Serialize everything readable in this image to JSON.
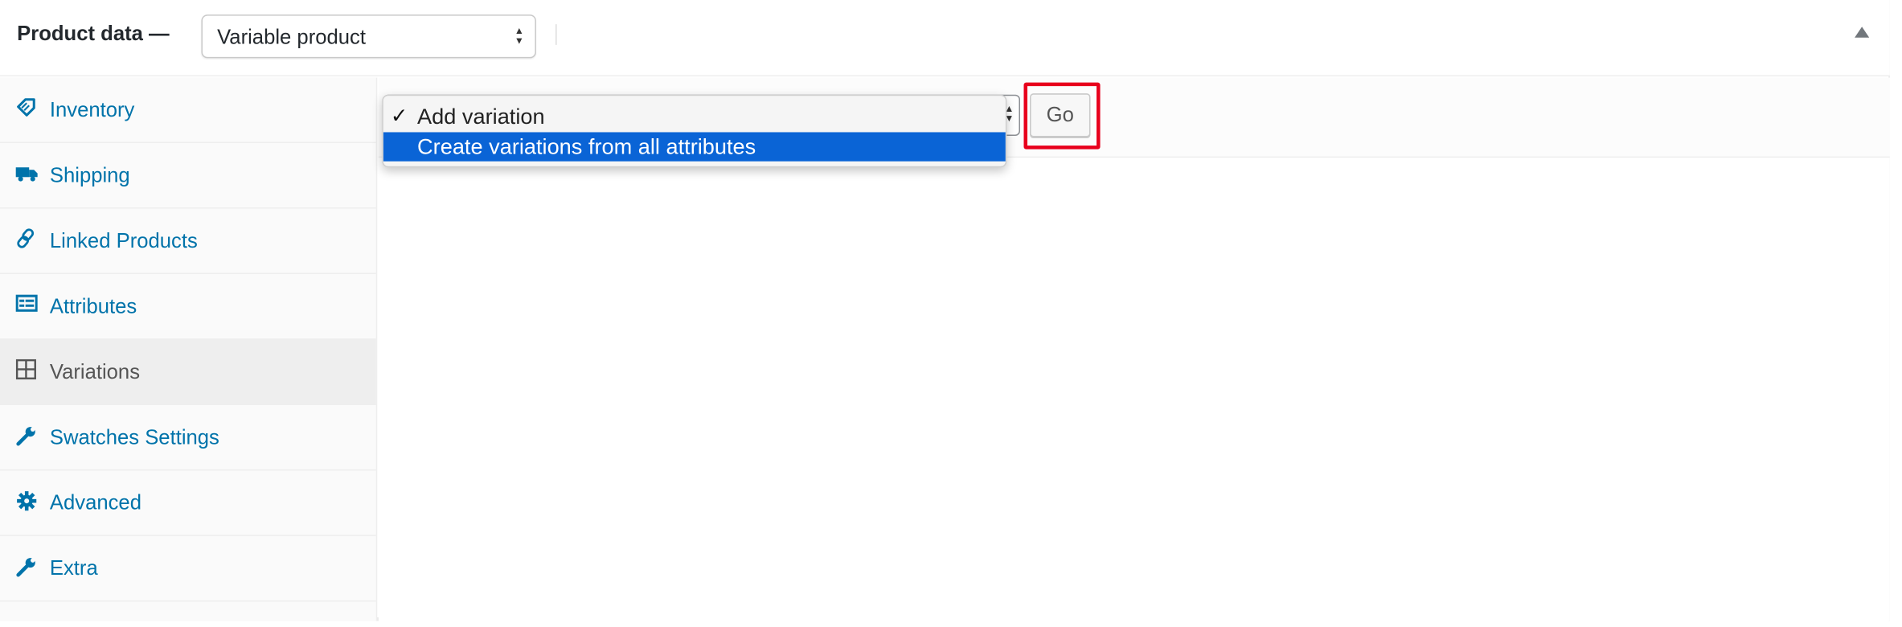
{
  "header": {
    "title": "Product data —",
    "product_type": "Variable product"
  },
  "sidebar": {
    "items": [
      {
        "label": "Inventory",
        "icon": "tag-icon",
        "active": false
      },
      {
        "label": "Shipping",
        "icon": "truck-icon",
        "active": false
      },
      {
        "label": "Linked Products",
        "icon": "link-icon",
        "active": false
      },
      {
        "label": "Attributes",
        "icon": "list-card-icon",
        "active": false
      },
      {
        "label": "Variations",
        "icon": "grid-icon",
        "active": true
      },
      {
        "label": "Swatches Settings",
        "icon": "wrench-icon",
        "active": false
      },
      {
        "label": "Advanced",
        "icon": "gear-icon",
        "active": false
      },
      {
        "label": "Extra",
        "icon": "wrench-icon",
        "active": false
      }
    ]
  },
  "variations": {
    "dropdown_options": [
      {
        "label": "Add variation",
        "checked": true
      },
      {
        "label": "Create variations from all attributes",
        "highlighted": true
      }
    ],
    "go_label": "Go"
  },
  "colors": {
    "link": "#0073aa",
    "active_tab_bg": "#eeeeee",
    "selection_blue": "#0a64d6",
    "highlight_red": "#e8001c"
  }
}
